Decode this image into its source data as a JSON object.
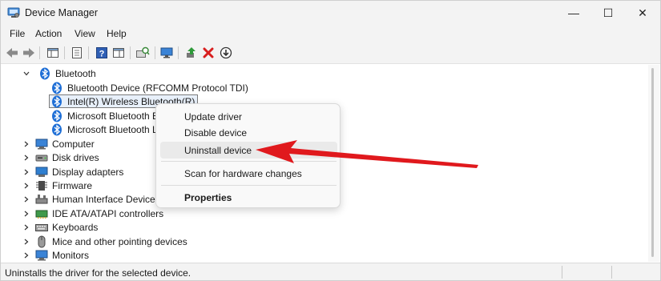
{
  "window": {
    "title": "Device Manager",
    "minimize_glyph": "—",
    "maximize_glyph": "☐",
    "close_glyph": "✕"
  },
  "menu": [
    "File",
    "Action",
    "View",
    "Help"
  ],
  "toolbar": {
    "buttons": [
      "back-icon",
      "forward-icon",
      "show-hide-console-tree-icon",
      "properties-icon",
      "help-icon",
      "console-icon",
      "scan-hardware-changes-icon",
      "update-driver-icon",
      "enable-device-icon",
      "uninstall-device-icon",
      "download-icon"
    ]
  },
  "tree": {
    "bluetooth": {
      "label": "Bluetooth",
      "children": [
        "Bluetooth Device (RFCOMM Protocol TDI)",
        "Intel(R) Wireless Bluetooth(R)",
        "Microsoft Bluetooth E",
        "Microsoft Bluetooth L"
      ]
    },
    "categories": [
      "Computer",
      "Disk drives",
      "Display adapters",
      "Firmware",
      "Human Interface Devices",
      "IDE ATA/ATAPI controllers",
      "Keyboards",
      "Mice and other pointing devices",
      "Monitors"
    ]
  },
  "context_menu": {
    "update_driver": "Update driver",
    "disable_device": "Disable device",
    "uninstall_device": "Uninstall device",
    "scan_hardware": "Scan for hardware changes",
    "properties": "Properties"
  },
  "status": {
    "text": "Uninstalls the driver for the selected device."
  },
  "colors": {
    "bluetooth_blue": "#1f6fd6",
    "arrow_red": "#e0191d",
    "uninstall_red": "#d81e1e"
  }
}
